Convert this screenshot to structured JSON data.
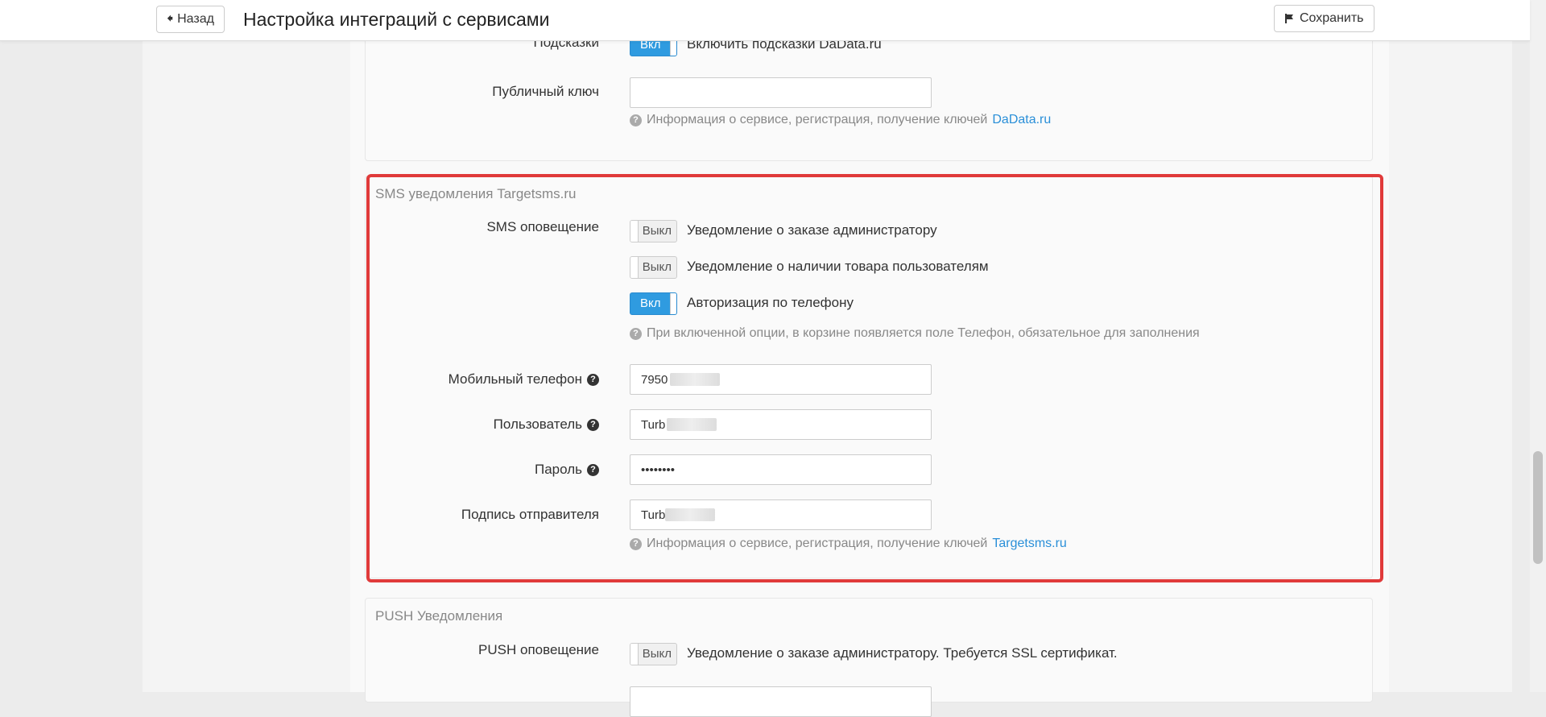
{
  "header": {
    "back_label": "Назад",
    "title": "Настройка интеграций с сервисами",
    "save_label": "Сохранить"
  },
  "dadata": {
    "hints_label": "Подсказки",
    "hints_toggle": "Вкл",
    "hints_text": "Включить подсказки DaData.ru",
    "public_key_label": "Публичный ключ",
    "public_key_value": "",
    "info_text": "Информация о сервисе, регистрация, получение ключей",
    "info_link": "DaData.ru"
  },
  "sms": {
    "title": "SMS уведомления Targetsms.ru",
    "notify_label": "SMS оповещение",
    "options": [
      {
        "toggle": "Выкл",
        "state": "off",
        "text": "Уведомление о заказе администратору"
      },
      {
        "toggle": "Выкл",
        "state": "off",
        "text": "Уведомление о наличии товара пользователям"
      },
      {
        "toggle": "Вкл",
        "state": "on",
        "text": "Авторизация по телефону"
      }
    ],
    "phone_auth_help": "При включенной опции, в корзине появляется поле Телефон, обязательное для заполнения",
    "mobile_label": "Мобильный телефон",
    "mobile_value": "7950",
    "user_label": "Пользователь",
    "user_value": "Turb",
    "password_label": "Пароль",
    "password_value": "••••••••",
    "sender_label": "Подпись отправителя",
    "sender_value": "Turb",
    "info_text": "Информация о сервисе, регистрация, получение ключей",
    "info_link": "Targetsms.ru"
  },
  "push": {
    "title": "PUSH Уведомления",
    "notify_label": "PUSH оповещение",
    "toggle": "Выкл",
    "text": "Уведомление о заказе администратору. Требуется SSL сертификат."
  },
  "colors": {
    "accent": "#2f9be0",
    "highlight": "#e03a3a",
    "link": "#2a8fd8"
  }
}
